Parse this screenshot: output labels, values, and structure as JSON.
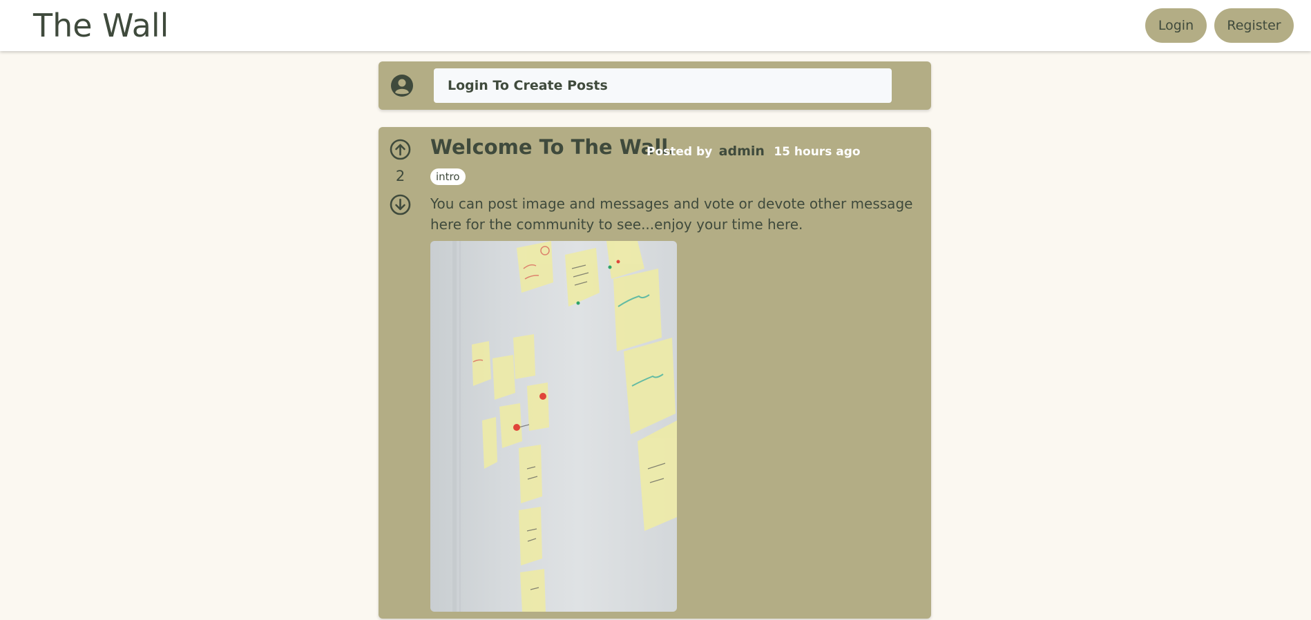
{
  "navbar": {
    "brand": "The Wall",
    "login_label": "Login",
    "register_label": "Register"
  },
  "create_post": {
    "placeholder": "Login To Create Posts",
    "avatar_icon": "user-circle-icon"
  },
  "post": {
    "title": "Welcome To The Wall.",
    "posted_by_label": "Posted by",
    "author": "admin",
    "time_ago": "15 hours ago",
    "tag": "intro",
    "votes": "2",
    "body": "You can post image and messages and vote or devote other message here for the community to see...enjoy your time here.",
    "upvote_icon": "arrow-up-circle-icon",
    "downvote_icon": "arrow-down-circle-icon",
    "image_icon": "sticky-notes-photo"
  },
  "colors": {
    "background": "#fbf8f1",
    "card": "#b3ad85",
    "text": "#3f4a3c",
    "navbar": "#ffffff"
  }
}
